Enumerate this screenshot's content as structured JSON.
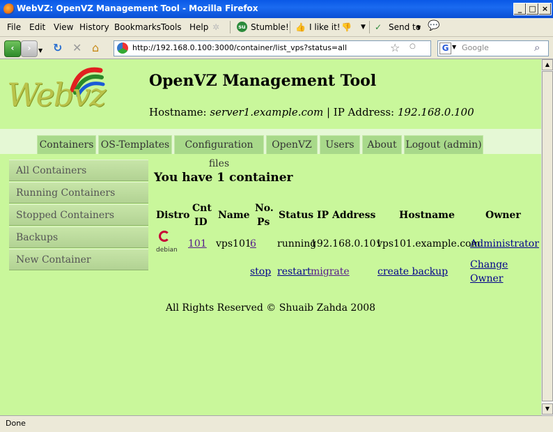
{
  "window": {
    "title": "WebVZ: OpenVZ Management Tool - Mozilla Firefox"
  },
  "menu": {
    "items": [
      "File",
      "Edit",
      "View",
      "History",
      "Bookmarks",
      "Tools",
      "Help"
    ],
    "stumble": "Stumble!",
    "ilike": "I like it!",
    "sendto": "Send to"
  },
  "nav": {
    "url": "http://192.168.0.100:3000/container/list_vps?status=all",
    "search_placeholder": "Google"
  },
  "page": {
    "logo_text": "Webvz",
    "title": "OpenVZ Management Tool",
    "hostname_label": "Hostname:",
    "hostname": "server1.example.com",
    "ip_label": "| IP Address:",
    "ip": "192.168.0.100",
    "tabs": [
      "Containers",
      "OS-Templates",
      "Configuration files",
      "OpenVZ",
      "Users",
      "About",
      "Logout (admin)"
    ],
    "sidebar": [
      "All Containers",
      "Running Containers",
      "Stopped Containers",
      "Backups",
      "New Container"
    ],
    "heading": "You have 1 container",
    "table": {
      "headers": {
        "distro": "Distro",
        "cnt1": "Cnt",
        "cnt2": "ID",
        "name": "Name",
        "nops1": "No.",
        "nops2": "Ps",
        "status": "Status",
        "ip": "IP Address",
        "hostname": "Hostname",
        "owner": "Owner"
      },
      "row": {
        "distro": "debian",
        "id": "101",
        "name": "vps101",
        "ps": "6",
        "status": "running",
        "ip": "192.168.0.101",
        "hostname": "vps101.example.com",
        "owner": "Administrator"
      },
      "actions": {
        "stop": "stop",
        "restart": "restart",
        "migrate": "migrate",
        "backup": "create backup",
        "change1": "Change",
        "change2": "Owner"
      }
    },
    "footer": "All Rights Reserved © Shuaib Zahda 2008"
  },
  "status": {
    "text": "Done"
  }
}
